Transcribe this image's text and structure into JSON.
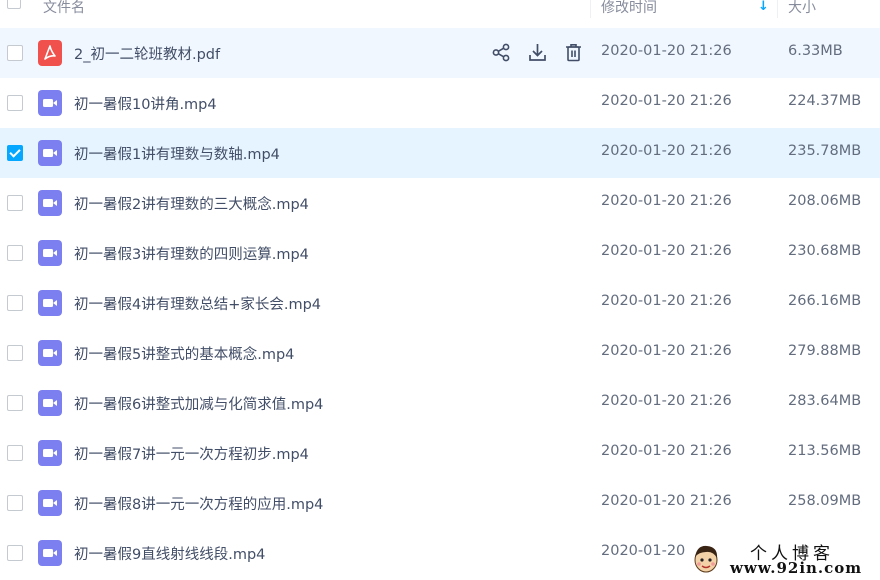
{
  "header": {
    "name_label": "文件名",
    "time_label": "修改时间",
    "size_label": "大小",
    "sort_arrow": "↓"
  },
  "files": [
    {
      "name": "2_初一二轮班教材.pdf",
      "time": "2020-01-20 21:26",
      "size": "6.33MB",
      "type": "pdf",
      "checked": false,
      "hover": true
    },
    {
      "name": "初一暑假10讲角.mp4",
      "time": "2020-01-20 21:26",
      "size": "224.37MB",
      "type": "video",
      "checked": false
    },
    {
      "name": "初一暑假1讲有理数与数轴.mp4",
      "time": "2020-01-20 21:26",
      "size": "235.78MB",
      "type": "video",
      "checked": true
    },
    {
      "name": "初一暑假2讲有理数的三大概念.mp4",
      "time": "2020-01-20 21:26",
      "size": "208.06MB",
      "type": "video",
      "checked": false
    },
    {
      "name": "初一暑假3讲有理数的四则运算.mp4",
      "time": "2020-01-20 21:26",
      "size": "230.68MB",
      "type": "video",
      "checked": false
    },
    {
      "name": "初一暑假4讲有理数总结+家长会.mp4",
      "time": "2020-01-20 21:26",
      "size": "266.16MB",
      "type": "video",
      "checked": false
    },
    {
      "name": "初一暑假5讲整式的基本概念.mp4",
      "time": "2020-01-20 21:26",
      "size": "279.88MB",
      "type": "video",
      "checked": false
    },
    {
      "name": "初一暑假6讲整式加减与化简求值.mp4",
      "time": "2020-01-20 21:26",
      "size": "283.64MB",
      "type": "video",
      "checked": false
    },
    {
      "name": "初一暑假7讲一元一次方程初步.mp4",
      "time": "2020-01-20 21:26",
      "size": "213.56MB",
      "type": "video",
      "checked": false
    },
    {
      "name": "初一暑假8讲一元一次方程的应用.mp4",
      "time": "2020-01-20 21:26",
      "size": "258.09MB",
      "type": "video",
      "checked": false
    },
    {
      "name": "初一暑假9直线射线线段.mp4",
      "time": "2020-01-20",
      "size": "",
      "type": "video",
      "checked": false
    }
  ],
  "row_actions": {
    "share_icon": "share-icon",
    "download_icon": "download-icon",
    "delete_icon": "trash-icon"
  },
  "watermark": {
    "title": "个人博客",
    "url": "www.92in.com"
  },
  "colors": {
    "accent": "#06a7ff",
    "pdf": "#f0514d",
    "video": "#7b7ff0",
    "selected_row": "#e6f4ff",
    "hover_row": "#f0f7ff"
  }
}
